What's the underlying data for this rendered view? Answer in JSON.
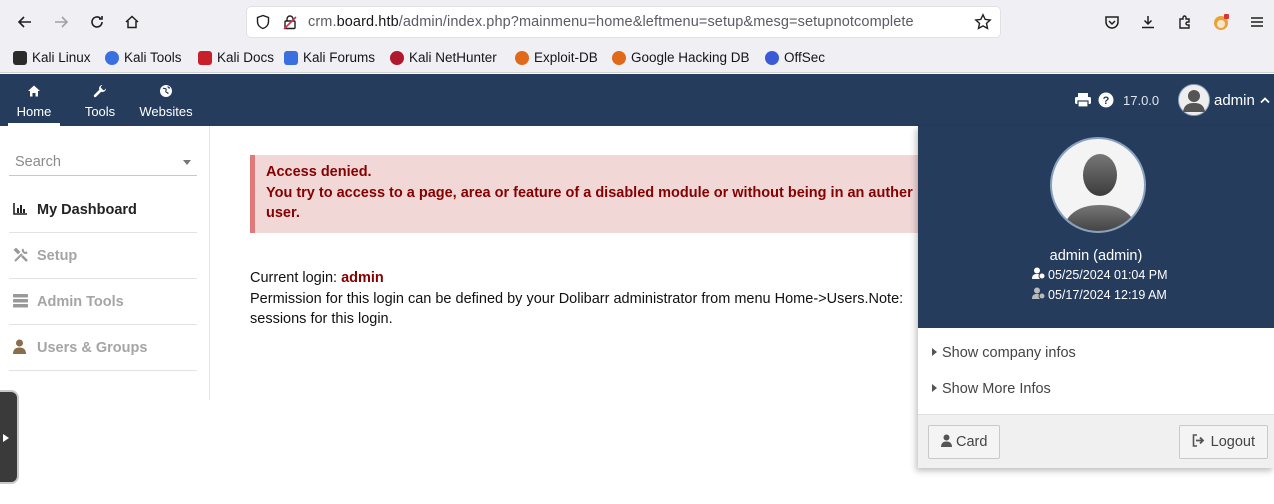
{
  "browser": {
    "url_prefix": "crm.",
    "url_host": "board.htb",
    "url_path": "/admin/index.php?mainmenu=home&leftmenu=setup&mesg=setupnotcomplete",
    "bookmarks": [
      "Kali Linux",
      "Kali Tools",
      "Kali Docs",
      "Kali Forums",
      "Kali NetHunter",
      "Exploit-DB",
      "Google Hacking DB",
      "OffSec"
    ]
  },
  "topmenu": {
    "items": [
      {
        "label": "Home",
        "icon": "home-icon"
      },
      {
        "label": "Tools",
        "icon": "wrench-icon"
      },
      {
        "label": "Websites",
        "icon": "globe-icon"
      }
    ],
    "version": "17.0.0",
    "user": "admin"
  },
  "sidebar": {
    "search_placeholder": "Search",
    "items": [
      {
        "label": "My Dashboard",
        "icon": "chart-icon"
      },
      {
        "label": "Setup",
        "icon": "tools-icon"
      },
      {
        "label": "Admin Tools",
        "icon": "server-icon"
      },
      {
        "label": "Users & Groups",
        "icon": "user-icon"
      }
    ]
  },
  "main": {
    "error_title": "Access denied.",
    "error_line2": "You try to access to a page, area or feature of a disabled module or without being in an auther",
    "error_line3": "user.",
    "current_login_label": "Current login: ",
    "current_login_value": "admin",
    "permission_line1": "Permission for this login can be defined by your Dolibarr administrator from menu Home->Users.Note: ",
    "permission_line2": "sessions for this login."
  },
  "user_panel": {
    "name": "admin (admin)",
    "date_last_login": "05/25/2024 01:04 PM",
    "date_previous_login": "05/17/2024 12:19 AM",
    "show_company": "Show company infos",
    "show_more": "Show More Infos",
    "card_label": "Card",
    "logout_label": "Logout"
  },
  "colors": {
    "topbar": "#263c5c",
    "error_bg": "#f2d7d7",
    "error_text": "#850000"
  }
}
